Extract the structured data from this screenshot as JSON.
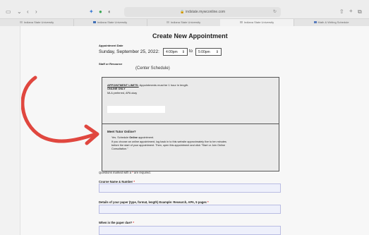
{
  "browser": {
    "url": "indstate.mywconline.com",
    "tabs": [
      {
        "label": "Indiana State University"
      },
      {
        "label": "Indiana State University"
      },
      {
        "label": "Indiana State University"
      },
      {
        "label": "Indiana State University"
      },
      {
        "label": "Math & Writing Schedule"
      }
    ]
  },
  "page": {
    "title": "Create New Appointment",
    "appointment_date_label": "Appointment Date",
    "date_text": "Sunday, September 25, 2022:",
    "start_time": "4:00pm",
    "to_label": "to",
    "end_time": "5:00pm",
    "staff_label": "Staff or Resource",
    "staff_value": "(Center Schedule)",
    "limits": {
      "heading": "APPOINTMENT LIMITS:",
      "text": " Appointments must be 1 hour in length.",
      "online_only": "ONLINE ONLY",
      "preference": "MLA preferred, APA okay"
    },
    "tutor_online": {
      "heading": "Meet Tutor Online?",
      "line1_prefix": "Yes. Schedule ",
      "line1_bold": "Online",
      "line1_suffix": " appointment.",
      "line2": "If you choose an online appointment, log back in to this website approximately five to ten minutes",
      "line3": "before the start of your appointment. Then, open this appointment and click \"Start or Join Online",
      "line4": "Consultation.\""
    },
    "required_note_prefix": "Questions marked with a ",
    "required_note_star": "*",
    "required_note_suffix": " are required.",
    "fields": [
      {
        "label": "Course Name & Number ",
        "star": "*"
      },
      {
        "label": "Details of your paper (type, format, length) Example: Research, APA, 5 pages ",
        "star": "*"
      },
      {
        "label": "When is the paper due? ",
        "star": "*"
      }
    ]
  },
  "colors": {
    "background": "#f4dcdc",
    "annotation_arrow": "#e0473f",
    "required_star": "#dd2222"
  }
}
